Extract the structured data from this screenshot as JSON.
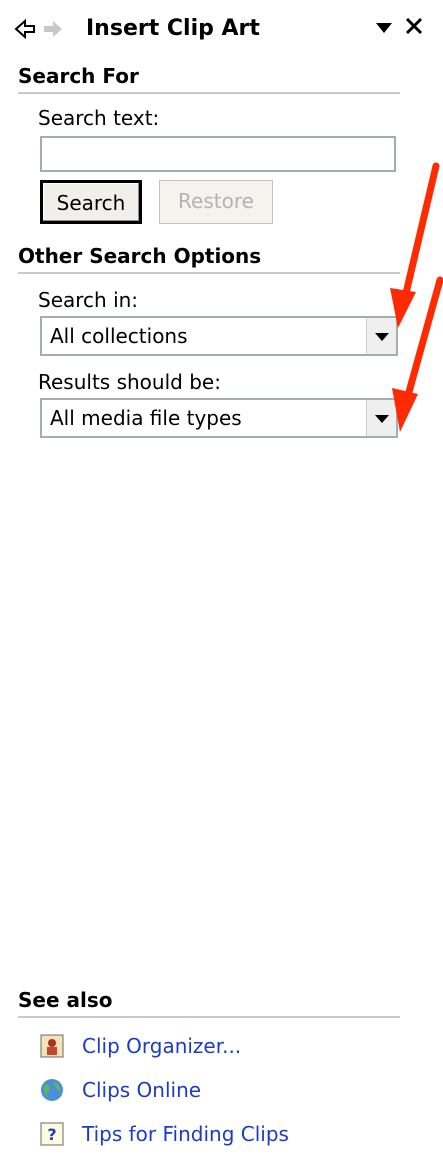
{
  "header": {
    "title": "Insert Clip Art",
    "back_icon": "back-arrow-icon",
    "forward_icon": "forward-arrow-icon"
  },
  "search_for": {
    "heading": "Search For",
    "search_text_label": "Search text:",
    "search_text_value": "",
    "search_button": "Search",
    "restore_button": "Restore"
  },
  "other_options": {
    "heading": "Other Search Options",
    "search_in_label": "Search in:",
    "search_in_value": "All collections",
    "results_label": "Results should be:",
    "results_value": "All media file types"
  },
  "see_also": {
    "heading": "See also",
    "links": [
      {
        "label": "Clip Organizer...",
        "icon": "clip-organizer-icon"
      },
      {
        "label": "Clips Online",
        "icon": "globe-icon"
      },
      {
        "label": "Tips for Finding Clips",
        "icon": "help-icon"
      }
    ]
  },
  "colors": {
    "link": "#1c3cc7",
    "annotation_arrow": "#ff2a00",
    "divider": "#c9c9c9"
  }
}
